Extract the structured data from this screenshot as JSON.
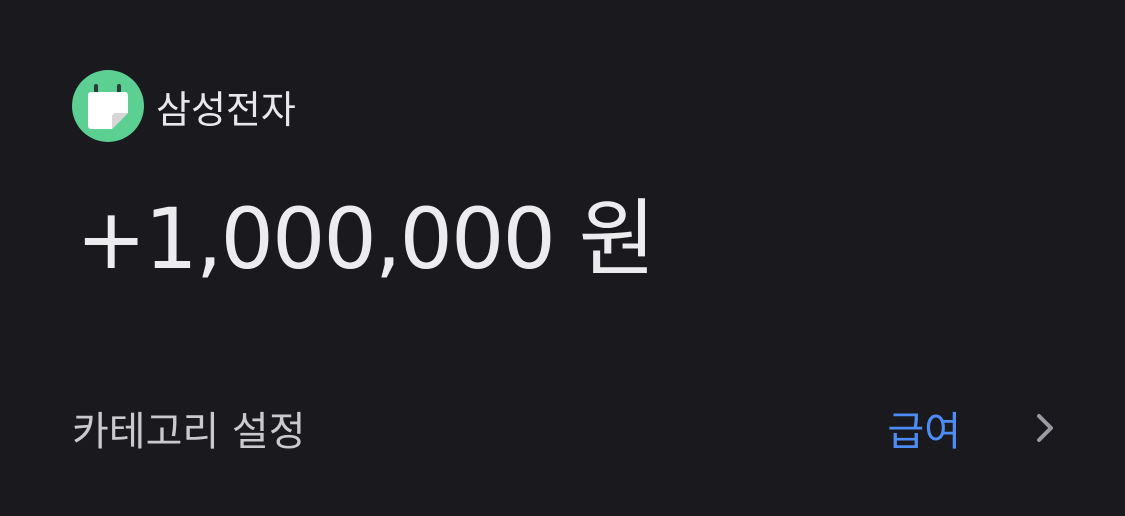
{
  "merchant": {
    "name": "삼성전자",
    "icon": "calendar-note-icon",
    "icon_color": "#5ccf92"
  },
  "amount": "+1,000,000 원",
  "category_row": {
    "label": "카테고리 설정",
    "value": "급여",
    "value_color": "#4e8cf5"
  }
}
